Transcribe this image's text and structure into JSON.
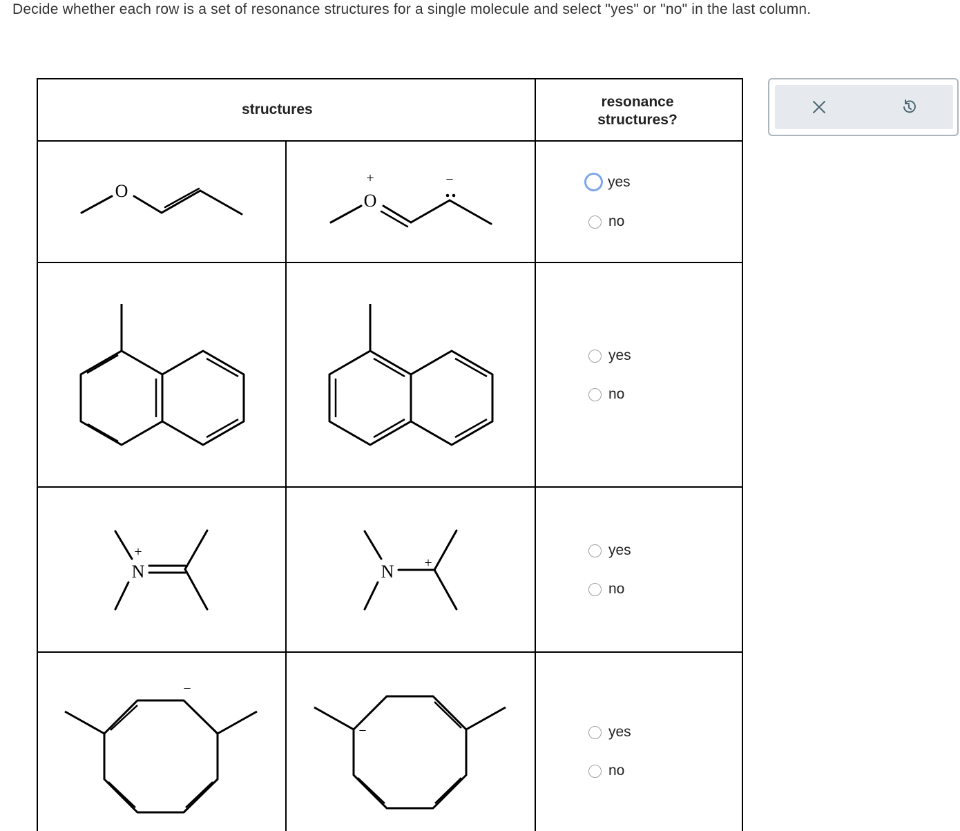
{
  "prompt": "Decide whether each row is a set of resonance structures for a single molecule and select \"yes\" or \"no\" in the last column.",
  "table": {
    "header_structures": "structures",
    "header_resonance_line1": "resonance",
    "header_resonance_line2": "structures?"
  },
  "rows": [
    {
      "options": [
        {
          "label": "yes"
        },
        {
          "label": "no"
        }
      ],
      "focused": "yes"
    },
    {
      "options": [
        {
          "label": "yes"
        },
        {
          "label": "no"
        }
      ]
    },
    {
      "options": [
        {
          "label": "yes"
        },
        {
          "label": "no"
        }
      ]
    },
    {
      "options": [
        {
          "label": "yes"
        },
        {
          "label": "no"
        }
      ]
    }
  ],
  "atom_labels": {
    "oxygen": "O",
    "nitrogen": "N",
    "plus": "+",
    "minus": "−",
    "lone_pair": ":"
  },
  "toolbar": {
    "clear_icon": "close-icon",
    "reset_icon": "undo-icon",
    "icon_color": "#4a6672"
  }
}
